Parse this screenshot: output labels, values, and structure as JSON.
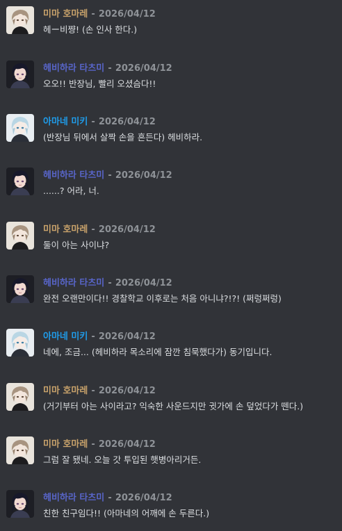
{
  "colors": {
    "background": "#313338",
    "mima": "#c9a36b",
    "hebihara": "#5865c9",
    "amane": "#1f9be8",
    "timestamp": "#8e9297",
    "text": "#dbdee1"
  },
  "messages": [
    {
      "author": "미마 호마레",
      "separator": "-",
      "date": "2026/04/12",
      "text": "헤ー비쨩! (손 인사 한다.)",
      "avatar": "mima-avatar",
      "color": "#c9a36b"
    },
    {
      "author": "헤비하라 타츠미",
      "separator": "-",
      "date": "2026/04/12",
      "text": "오오!! 반장님, 빨리 오셨슴다!!",
      "avatar": "hebihara-avatar",
      "color": "#5865c9"
    },
    {
      "author": "아마네 미키",
      "separator": "-",
      "date": "2026/04/12",
      "text": "(반장님 뒤에서 살짝 손을 흔든다) 헤비하라.",
      "avatar": "amane-avatar",
      "color": "#1f9be8"
    },
    {
      "author": "헤비하라 타츠미",
      "separator": "-",
      "date": "2026/04/12",
      "text": "......? 어라, 너.",
      "avatar": "hebihara-avatar",
      "color": "#5865c9"
    },
    {
      "author": "미마 호마레",
      "separator": "-",
      "date": "2026/04/12",
      "text": "둘이 아는 사이냐?",
      "avatar": "mima-avatar",
      "color": "#c9a36b"
    },
    {
      "author": "헤비하라 타츠미",
      "separator": "-",
      "date": "2026/04/12",
      "text": "완전 오랜만이다!! 경찰학교 이후로는 처음 아니냐?!?! (쩌렁쩌렁)",
      "avatar": "hebihara-avatar",
      "color": "#5865c9"
    },
    {
      "author": "아마네 미키",
      "separator": "-",
      "date": "2026/04/12",
      "text": "네에, 조금... (헤비하라 목소리에 잠깐 침묵했다가) 동기입니다.",
      "avatar": "amane-avatar",
      "color": "#1f9be8"
    },
    {
      "author": "미마 호마레",
      "separator": "-",
      "date": "2026/04/12",
      "text": "(거기부터 아는 사이라고? 익숙한 사운드지만 귓가에 손 덮었다가 뗀다.)",
      "avatar": "mima-avatar",
      "color": "#c9a36b"
    },
    {
      "author": "미마 호마레",
      "separator": "-",
      "date": "2026/04/12",
      "text": "그럼 잘 됐네. 오늘 갓 투입된 햇병아리거든.",
      "avatar": "mima-avatar",
      "color": "#c9a36b"
    },
    {
      "author": "헤비하라 타츠미",
      "separator": "-",
      "date": "2026/04/12",
      "text": "친한 친구임다!! (아마네의 어깨에 손 두른다.)",
      "avatar": "hebihara-avatar",
      "color": "#5865c9"
    }
  ]
}
